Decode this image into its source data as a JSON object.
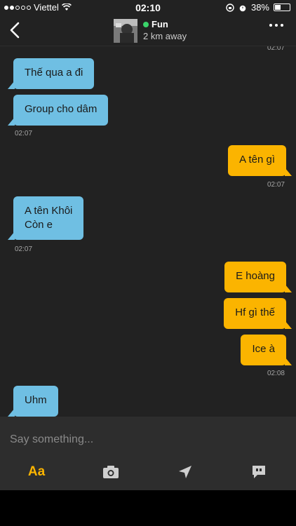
{
  "status_bar": {
    "carrier": "Viettel",
    "time": "02:10",
    "battery": "38%",
    "battery_level": 0.38
  },
  "header": {
    "name": "Fun",
    "distance": "2 km away",
    "back_icon": "chevron-left-icon",
    "more_icon": "more-horizontal-icon"
  },
  "chat": {
    "top_timestamp": "02:07",
    "messages": [
      {
        "dir": "in",
        "text": "Thế qua a đi"
      },
      {
        "dir": "in",
        "text": "Group cho dâm"
      },
      {
        "dir": "in_ts",
        "text": "02:07"
      },
      {
        "dir": "out",
        "text": "A tên gì"
      },
      {
        "dir": "out_ts",
        "text": "02:07"
      },
      {
        "dir": "in",
        "line1": "A tên Khôi",
        "line2": "Còn e"
      },
      {
        "dir": "in_ts",
        "text": "02:07"
      },
      {
        "dir": "out",
        "text": "E hoàng"
      },
      {
        "dir": "out",
        "text": "Hf gì thế"
      },
      {
        "dir": "out",
        "text": "Ice à"
      },
      {
        "dir": "out_ts",
        "text": "02:08"
      },
      {
        "dir": "in",
        "text": "Uhm"
      }
    ]
  },
  "composer": {
    "placeholder": "Say something...",
    "tools": [
      {
        "label": "Aa",
        "icon": "text-format-icon"
      },
      {
        "icon": "camera-icon"
      },
      {
        "icon": "location-arrow-icon"
      },
      {
        "icon": "saved-phrases-icon"
      }
    ],
    "accent": "#fbb400",
    "incoming_color": "#6fbfe3",
    "online_color": "#3ad36a"
  }
}
